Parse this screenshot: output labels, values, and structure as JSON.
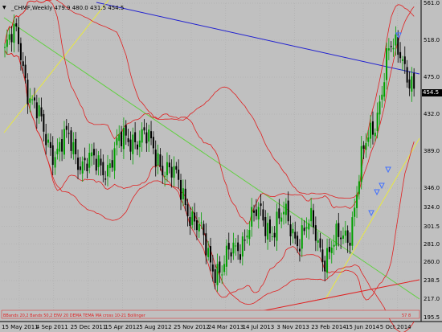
{
  "header": {
    "menu_glyph": "▼",
    "symbol": "_CHMF,Weekly",
    "ohlc": "479.9 480.0 431.5 454.5"
  },
  "price_axis": {
    "ticks": [
      "561.0",
      "518.0",
      "475.0",
      "454.5",
      "432.0",
      "389.0",
      "346.0",
      "324.0",
      "301.5",
      "281.0",
      "260.0",
      "238.5",
      "217.0",
      "195.5"
    ],
    "current_price": "454.5"
  },
  "time_axis": {
    "ticks": [
      "15 May 2011",
      "4 Sep 2011",
      "25 Dec 2011",
      "15 Apr 2012",
      "5 Aug 2012",
      "25 Nov 2012",
      "24 Mar 2013",
      "14 Jul 2013",
      "3 Nov 2013",
      "23 Feb 2014",
      "15 Jun 2014",
      "5 Oct 2014"
    ]
  },
  "indicator_strip": {
    "text": "BBands 20,2 Bands 50,2 ENV 20 DEMA TEMA MA cross 10-21 Bollinger",
    "value": "57 8"
  },
  "colors": {
    "background": "#c0c0c0",
    "grid": "#a8a8a8",
    "candle_up": "#00a000",
    "candle_down": "#000000",
    "bands": "#e02020",
    "trend_blue": "#2020d0",
    "trend_green": "#60d040",
    "trend_yellow": "#e8e840",
    "trend_red": "#e02020",
    "arrows": "#4070ff"
  },
  "chart_data": {
    "type": "candlestick",
    "timeframe": "Weekly",
    "symbol": "_CHMF",
    "ylim": [
      195.5,
      561.0
    ],
    "x": [
      "15 May 2011",
      "4 Sep 2011",
      "25 Dec 2011",
      "15 Apr 2012",
      "5 Aug 2012",
      "25 Nov 2012",
      "24 Mar 2013",
      "14 Jul 2013",
      "3 Nov 2013",
      "23 Feb 2014",
      "15 Jun 2014",
      "5 Oct 2014"
    ],
    "close_path": [
      505,
      525,
      450,
      410,
      390,
      400,
      380,
      370,
      375,
      395,
      410,
      400,
      385,
      360,
      340,
      300,
      265,
      250,
      275,
      300,
      315,
      300,
      310,
      290,
      300,
      270,
      280,
      300,
      380,
      430,
      500,
      510,
      454.5
    ],
    "last": {
      "open": 479.9,
      "high": 480.0,
      "low": 431.5,
      "close": 454.5
    }
  }
}
